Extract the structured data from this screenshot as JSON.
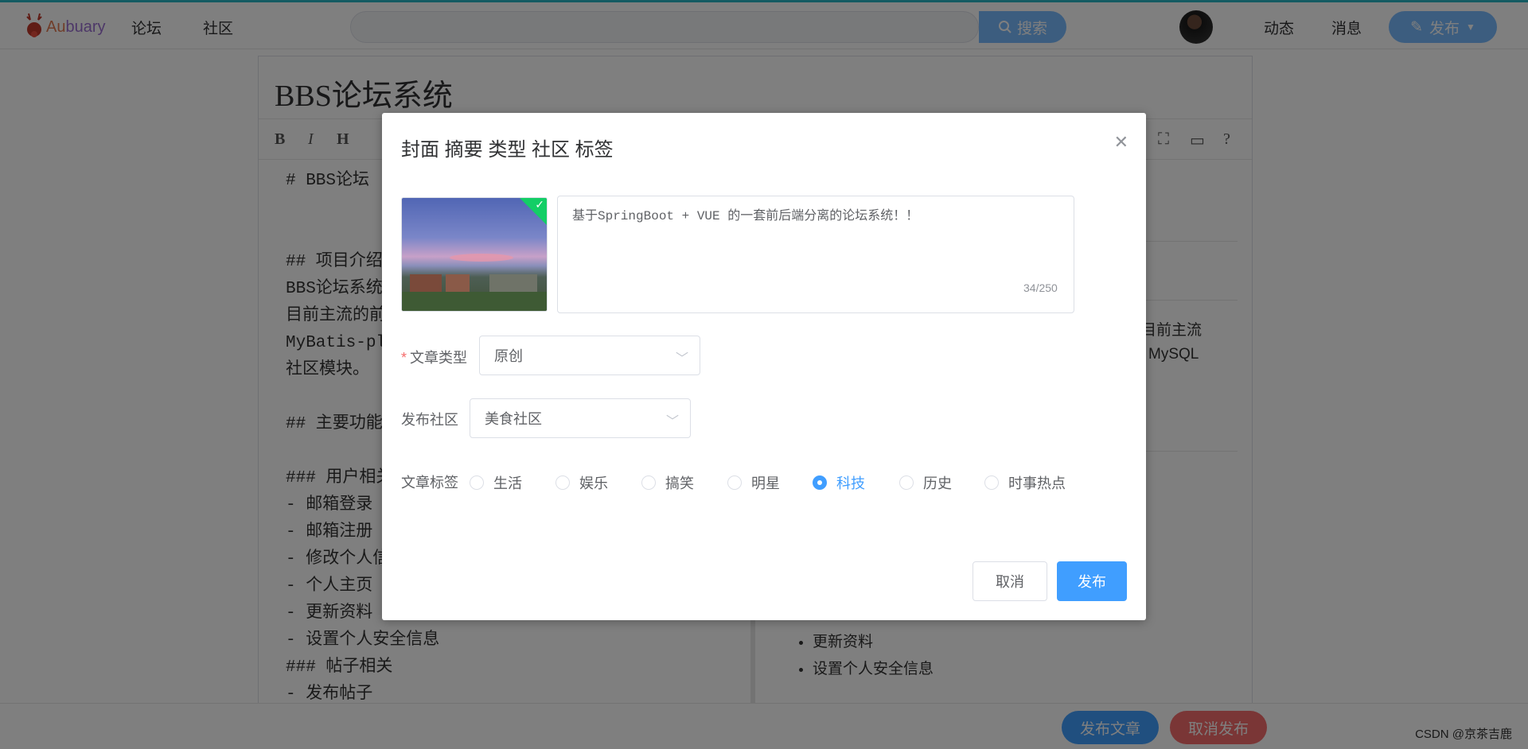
{
  "header": {
    "logo_text_a": "Au",
    "logo_text_b": "buary",
    "nav": [
      "论坛",
      "社区"
    ],
    "search": {
      "placeholder": "",
      "button_label": "搜索"
    },
    "links": [
      "动态",
      "消息"
    ],
    "publish_label": "发布"
  },
  "editor": {
    "title": "BBS论坛系统",
    "toolbar": [
      "B",
      "I",
      "H"
    ],
    "markdown_lines": [
      "# BBS论坛",
      "",
      "",
      "## 项目介绍",
      "BBS论坛系统",
      "目前主流的前",
      "MyBatis-pl",
      "社区模块。",
      "",
      "## 主要功能",
      "",
      "### 用户相关",
      "- 邮箱登录",
      "- 邮箱注册",
      "- 修改个人信",
      "- 个人主页",
      "- 更新资料",
      "- 设置个人安全信息",
      "### 帖子相关",
      "- 发布帖子"
    ],
    "preview_snippets": [
      "于目前主流",
      "MySQL"
    ],
    "preview_list": [
      "更新资料",
      "设置个人安全信息"
    ]
  },
  "bottom_bar": {
    "publish_label": "发布文章",
    "cancel_label": "取消发布",
    "publish_color": "#409eff",
    "cancel_color": "#f56c6c"
  },
  "watermark": "CSDN @京茶吉鹿",
  "dialog": {
    "title": "封面 摘要 类型 社区 标签",
    "summary_text": "基于SpringBoot + VUE 的一套前后端分离的论坛系统！！",
    "summary_count": "34/250",
    "type_label": "文章类型",
    "type_value": "原创",
    "community_label": "发布社区",
    "community_value": "美食社区",
    "tags_label": "文章标签",
    "tags": [
      "生活",
      "娱乐",
      "搞笑",
      "明星",
      "科技",
      "历史",
      "时事热点"
    ],
    "selected_tag": "科技",
    "cancel_label": "取消",
    "confirm_label": "发布",
    "accent_color": "#409eff"
  }
}
